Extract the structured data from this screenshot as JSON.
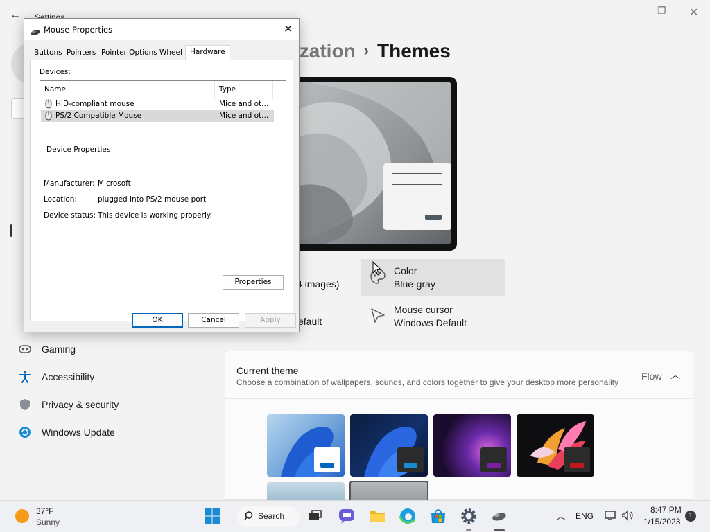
{
  "settings": {
    "title": "Settings",
    "breadcrumb": {
      "parent": "ization",
      "separator": "›",
      "current": "Themes"
    },
    "nav": [
      {
        "label": "Gaming",
        "icon": "gamepad-icon"
      },
      {
        "label": "Accessibility",
        "icon": "accessibility-icon"
      },
      {
        "label": "Privacy & security",
        "icon": "shield-icon"
      },
      {
        "label": "Windows Update",
        "icon": "update-icon"
      }
    ],
    "tiles": {
      "background_partial_line1": ")",
      "background_partial_line2": "4 images)",
      "sounds_partial": "efault",
      "color": {
        "title": "Color",
        "value": "Blue-gray"
      },
      "mouse_cursor": {
        "title": "Mouse cursor",
        "value": "Windows Default"
      }
    },
    "current_theme": {
      "title": "Current theme",
      "description": "Choose a combination of wallpapers, sounds, and colors together to give your desktop more personality",
      "value": "Flow"
    },
    "colors": {
      "accent_blue": "#0067c0",
      "selected_tile": "#e1e1e1"
    }
  },
  "dialog": {
    "title": "Mouse Properties",
    "tabs": [
      "Buttons",
      "Pointers",
      "Pointer Options",
      "Wheel",
      "Hardware"
    ],
    "active_tab": "Hardware",
    "devices_label": "Devices:",
    "columns": {
      "name": "Name",
      "type": "Type"
    },
    "devices": [
      {
        "name": "HID-compliant mouse",
        "type": "Mice and ot..."
      },
      {
        "name": "PS/2 Compatible Mouse",
        "type": "Mice and ot..."
      }
    ],
    "selected_device": "PS/2 Compatible Mouse",
    "device_properties_title": "Device Properties",
    "manufacturer_label": "Manufacturer:",
    "manufacturer": "Microsoft",
    "location_label": "Location:",
    "location": "plugged into PS/2 mouse port",
    "status_label": "Device status:",
    "status": "This device is working properly.",
    "properties_button": "Properties",
    "ok": "OK",
    "cancel": "Cancel",
    "apply": "Apply"
  },
  "taskbar": {
    "weather": {
      "temp": "37°F",
      "desc": "Sunny"
    },
    "search_label": "Search",
    "language": "ENG",
    "time": "8:47 PM",
    "date": "1/15/2023",
    "notifications": "1"
  }
}
